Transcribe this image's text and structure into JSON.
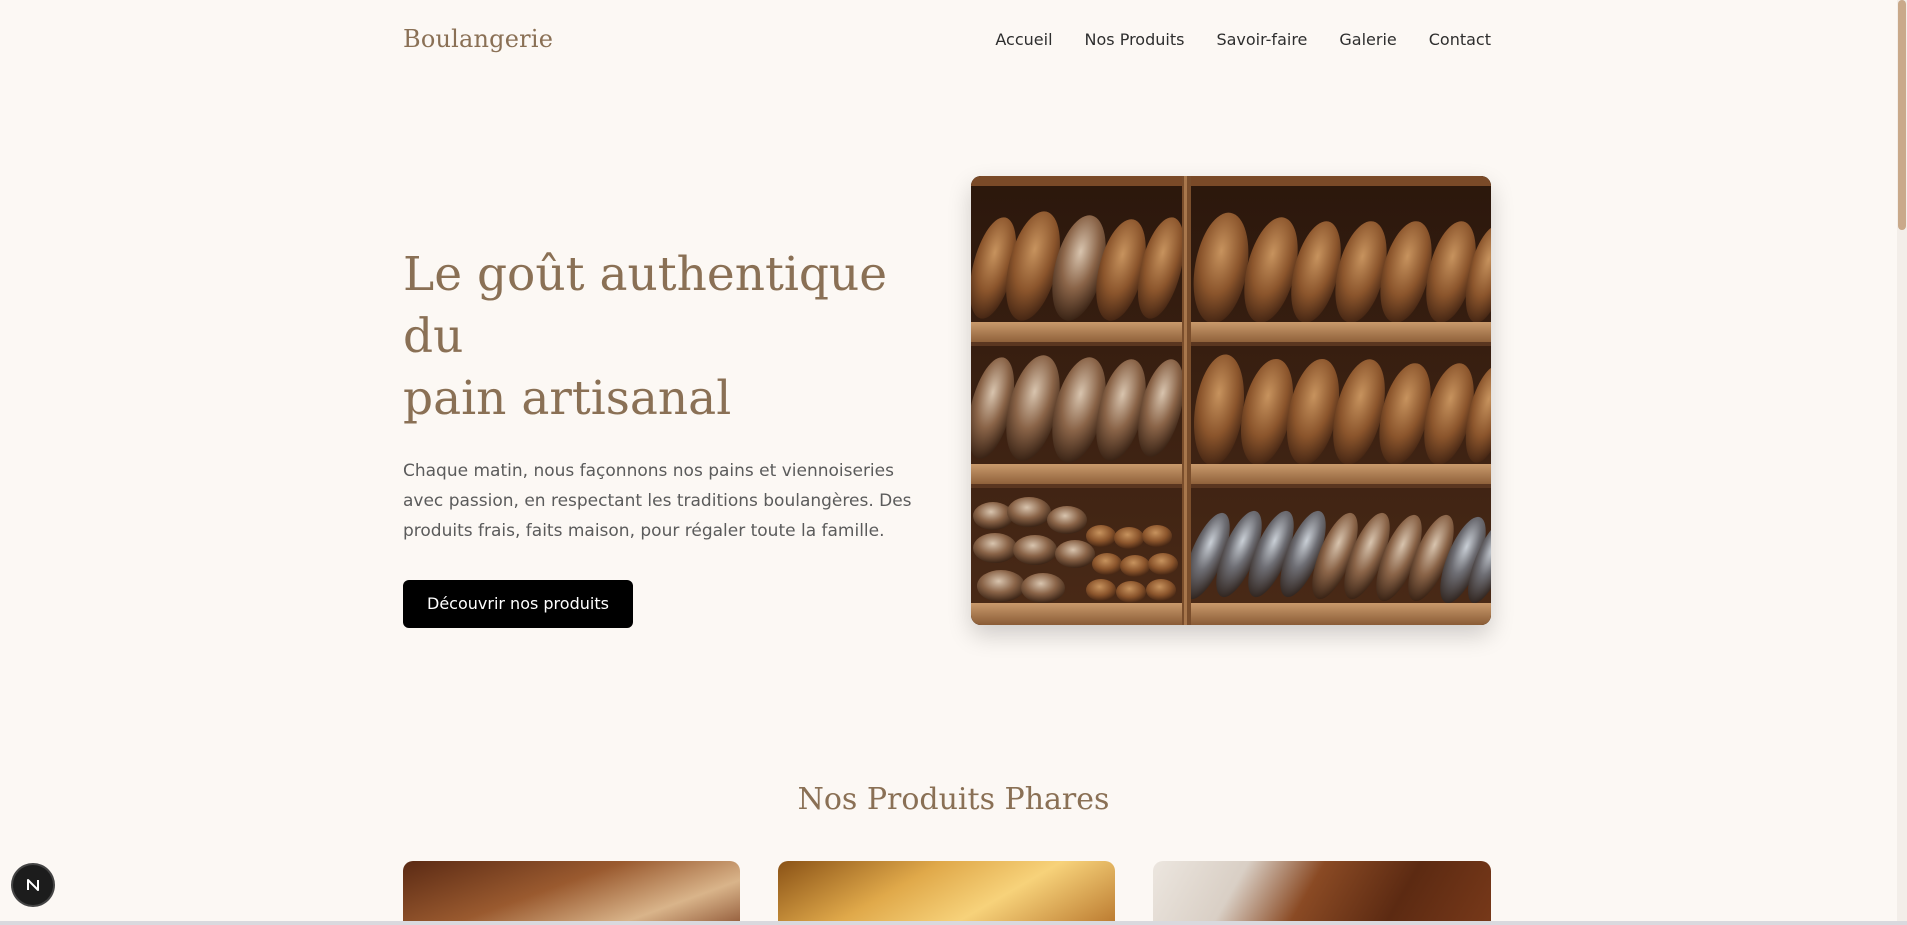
{
  "header": {
    "logo": "Boulangerie",
    "nav": [
      "Accueil",
      "Nos Produits",
      "Savoir-faire",
      "Galerie",
      "Contact"
    ]
  },
  "hero": {
    "title_line1": "Le goût authentique du",
    "title_line2": "pain artisanal",
    "description": "Chaque matin, nous façonnons nos pains et viennoiseries avec passion, en respectant les traditions boulangères. Des produits frais, faits maison, pour régaler toute la famille.",
    "cta_label": "Découvrir nos produits"
  },
  "products_section": {
    "title": "Nos Produits Phares"
  },
  "colors": {
    "accent": "#8a7055",
    "background": "#fcf8f4",
    "button": "#000000"
  }
}
